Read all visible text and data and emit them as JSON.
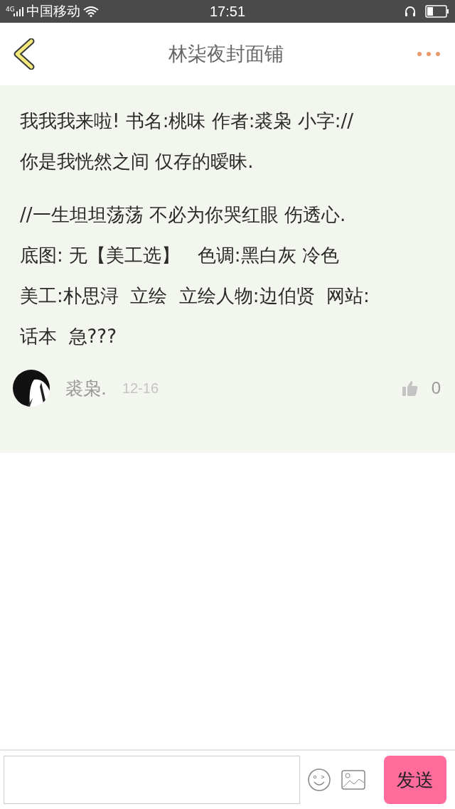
{
  "status_bar": {
    "network": "4G",
    "carrier": "中国移动",
    "time": "17:51"
  },
  "header": {
    "title": "林柒夜封面铺"
  },
  "post": {
    "paragraphs": [
      {
        "lines": [
          "我我我来啦! 书名:桃味 作者:裘枭 小字://",
          "你是我恍然之间 仅存的暧昧."
        ]
      },
      {
        "lines": [
          "//一生坦坦荡荡 不必为你哭红眼 伤透心.",
          "底图: 无【美工选】   色调:黑白灰 冷色",
          "美工:朴思浔  立绘  立绘人物:边伯贤  网站:",
          "话本  急???"
        ]
      }
    ],
    "author": "裘枭.",
    "date": "12-16",
    "likes": "0"
  },
  "composer": {
    "send": "发送"
  }
}
